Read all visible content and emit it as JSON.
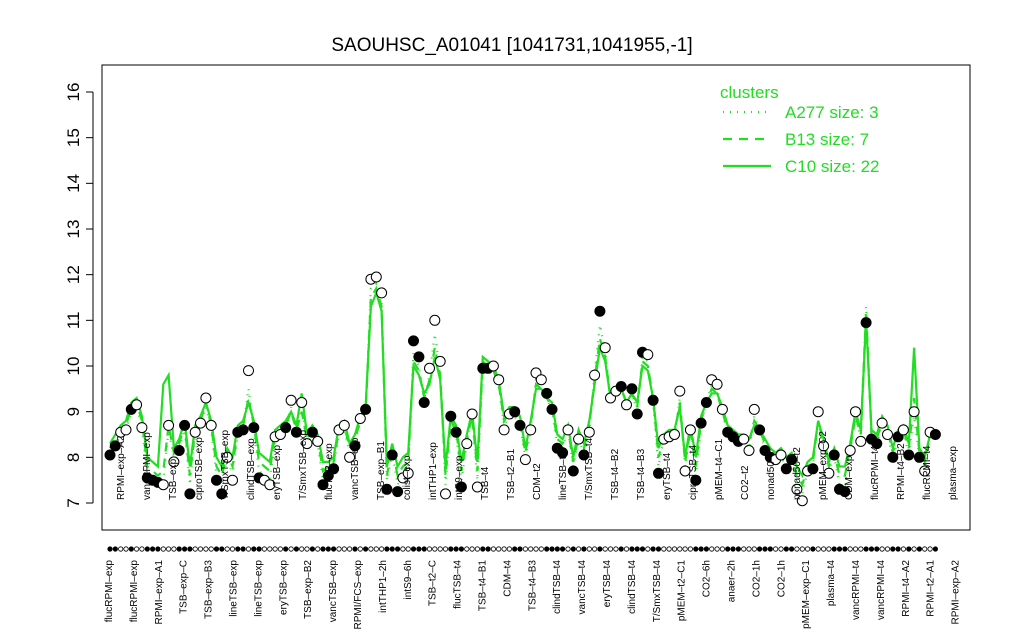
{
  "chart_data": {
    "type": "line",
    "title": "SAOUHSC_A01041 [1041731,1041955,-1]",
    "xlabel": "",
    "ylabel": "",
    "ylim": [
      7,
      16
    ],
    "yticks": [
      7,
      8,
      9,
      10,
      11,
      12,
      13,
      14,
      15,
      16
    ],
    "grid": false,
    "legend": {
      "title": "clusters",
      "placement": "top-right",
      "color": "#22dd22",
      "entries": [
        {
          "label": "A277 size: 3",
          "style": "dotted"
        },
        {
          "label": "B13 size: 7",
          "style": "dashed"
        },
        {
          "label": "C10 size: 22",
          "style": "solid"
        }
      ]
    },
    "x_labels_top": [
      "RPMI–exp–A2",
      "vancRPMI–exp",
      "TSB–exp",
      "ciproTSB–exp",
      "T/SmxTSB–exp",
      "clindTSB–exp",
      "eryTSB–exp",
      "T/SmxTSB–exp",
      "flucTSB–exp",
      "vancTSB–exp",
      "TSB–exp–B1",
      "colist–exp",
      "intTHP1–exp",
      "intS9–exp",
      "TSB–t4",
      "TSB–t2–B1",
      "CDM–t2",
      "lineTSB–t4",
      "T/SmxTSB–t4",
      "TSB–t4–B2",
      "TSB–t4–B3",
      "eryTSB–t4",
      "ciproTSB–t4",
      "pMEM–t4–C1",
      "CO2–t2",
      "nonad50–t",
      "nonad50–t2",
      "pMEM–exp–C2",
      "CDM–exp",
      "flucRPMI–t4",
      "RPMI–t4–B2",
      "flucRPMI–t4",
      "plasma–exp",
      "vancRPMI–exp"
    ],
    "x_labels_bottom": [
      "flucRPMI–exp",
      "flucRPMI–exp",
      "RPMI–exp–A1",
      "TSB–exp–C",
      "TSB–exp–B3",
      "lineTSB–exp",
      "lineTSB–exp",
      "eryTSB–exp",
      "TSB–exp–B2",
      "vancTSB–exp",
      "RPMI/FCS–exp",
      "intTHP1–2h",
      "intS9–6h",
      "TSB–t2–C",
      "flucTSB–t4",
      "TSB–t4–B1",
      "CDM–t4",
      "TSB–t4–B3",
      "clindTSB–t4",
      "vancTSB–t4",
      "eryTSB–t4",
      "clindTSB–t4",
      "T/SmxTSB–t4",
      "pMEM–t2–C1",
      "CO2–6h",
      "anaer–2h",
      "CO2–1h",
      "CO2–1h",
      "pMEM–exp–C1",
      "plasma–t4",
      "vancRPMI–t4",
      "vancRPMI–t4",
      "RPMI–t4–A2",
      "RPMI–t2–A1",
      "RPMI–exp–A2"
    ],
    "x": [
      1,
      2,
      3,
      4,
      5,
      6,
      7,
      8,
      9,
      10,
      11,
      12,
      13,
      14,
      15,
      16,
      17,
      18,
      19,
      20,
      21,
      22,
      23,
      24,
      25,
      26,
      27,
      28,
      29,
      30,
      31,
      32,
      33,
      34,
      35,
      36,
      37,
      38,
      39,
      40,
      41,
      42,
      43,
      44,
      45,
      46,
      47,
      48,
      49,
      50,
      51,
      52,
      53,
      54,
      55,
      56,
      57,
      58,
      59,
      60,
      61,
      62,
      63,
      64,
      65,
      66,
      67,
      68,
      69,
      70,
      71,
      72,
      73,
      74,
      75,
      76,
      77,
      78,
      79,
      80,
      81,
      82,
      83,
      84,
      85,
      86,
      87,
      88,
      89,
      90,
      91,
      92,
      93,
      94,
      95,
      96,
      97,
      98,
      99,
      100,
      101,
      102,
      103,
      104,
      105,
      106,
      107,
      108,
      109,
      110,
      111,
      112,
      113,
      114,
      115,
      116,
      117,
      118,
      119,
      120,
      121,
      122,
      123,
      124,
      125,
      126,
      127,
      128,
      129,
      130,
      131,
      132,
      133,
      134,
      135,
      136,
      137,
      138,
      139,
      140,
      141,
      142,
      143,
      144,
      145,
      146,
      147,
      148,
      149,
      150,
      151,
      152,
      153,
      154,
      155,
      156,
      157,
      158,
      159,
      160,
      161
    ],
    "points": [
      {
        "v": 8.05,
        "f": 1
      },
      {
        "v": 8.25,
        "f": 1
      },
      {
        "v": 8.55,
        "f": 0
      },
      {
        "v": 8.6,
        "f": 0
      },
      {
        "v": 9.05,
        "f": 1
      },
      {
        "v": 9.15,
        "f": 0
      },
      {
        "v": 8.65,
        "f": 0
      },
      {
        "v": 7.55,
        "f": 1
      },
      {
        "v": 7.5,
        "f": 1
      },
      {
        "v": 7.45,
        "f": 1
      },
      {
        "v": 7.4,
        "f": 0
      },
      {
        "v": 8.7,
        "f": 0
      },
      {
        "v": 7.9,
        "f": 0
      },
      {
        "v": 8.15,
        "f": 1
      },
      {
        "v": 8.7,
        "f": 1
      },
      {
        "v": 7.2,
        "f": 1
      },
      {
        "v": 8.55,
        "f": 0
      },
      {
        "v": 8.75,
        "f": 0
      },
      {
        "v": 9.3,
        "f": 0
      },
      {
        "v": 8.7,
        "f": 0
      },
      {
        "v": 7.5,
        "f": 1
      },
      {
        "v": 7.2,
        "f": 1
      },
      {
        "v": 8.0,
        "f": 0
      },
      {
        "v": 7.5,
        "f": 0
      },
      {
        "v": 8.55,
        "f": 1
      },
      {
        "v": 8.6,
        "f": 1
      },
      {
        "v": 9.9,
        "f": 0
      },
      {
        "v": 8.65,
        "f": 1
      },
      {
        "v": 7.55,
        "f": 1
      },
      {
        "v": 7.5,
        "f": 0
      },
      {
        "v": 7.4,
        "f": 0
      },
      {
        "v": 8.45,
        "f": 0
      },
      {
        "v": 8.5,
        "f": 0
      },
      {
        "v": 8.65,
        "f": 1
      },
      {
        "v": 9.25,
        "f": 0
      },
      {
        "v": 8.55,
        "f": 1
      },
      {
        "v": 9.2,
        "f": 0
      },
      {
        "v": 8.3,
        "f": 0
      },
      {
        "v": 8.55,
        "f": 1
      },
      {
        "v": 8.35,
        "f": 0
      },
      {
        "v": 7.4,
        "f": 1
      },
      {
        "v": 7.6,
        "f": 1
      },
      {
        "v": 7.75,
        "f": 1
      },
      {
        "v": 8.6,
        "f": 0
      },
      {
        "v": 8.7,
        "f": 0
      },
      {
        "v": 8.0,
        "f": 0
      },
      {
        "v": 8.25,
        "f": 1
      },
      {
        "v": 8.85,
        "f": 0
      },
      {
        "v": 9.05,
        "f": 1
      },
      {
        "v": 11.9,
        "f": 0
      },
      {
        "v": 11.95,
        "f": 0
      },
      {
        "v": 11.6,
        "f": 0
      },
      {
        "v": 7.3,
        "f": 1
      },
      {
        "v": 8.05,
        "f": 1
      },
      {
        "v": 7.25,
        "f": 1
      },
      {
        "v": 7.55,
        "f": 0
      },
      {
        "v": 7.65,
        "f": 0
      },
      {
        "v": 10.55,
        "f": 1
      },
      {
        "v": 10.2,
        "f": 1
      },
      {
        "v": 9.2,
        "f": 1
      },
      {
        "v": 9.95,
        "f": 0
      },
      {
        "v": 11.0,
        "f": 0
      },
      {
        "v": 10.1,
        "f": 0
      },
      {
        "v": 7.2,
        "f": 0
      },
      {
        "v": 8.9,
        "f": 1
      },
      {
        "v": 8.55,
        "f": 1
      },
      {
        "v": 7.35,
        "f": 1
      },
      {
        "v": 8.3,
        "f": 0
      },
      {
        "v": 8.95,
        "f": 0
      },
      {
        "v": 7.35,
        "f": 0
      },
      {
        "v": 9.95,
        "f": 1
      },
      {
        "v": 9.95,
        "f": 1
      },
      {
        "v": 10.0,
        "f": 0
      },
      {
        "v": 9.7,
        "f": 0
      },
      {
        "v": 8.6,
        "f": 0
      },
      {
        "v": 8.95,
        "f": 0
      },
      {
        "v": 9.0,
        "f": 1
      },
      {
        "v": 8.7,
        "f": 1
      },
      {
        "v": 7.95,
        "f": 0
      },
      {
        "v": 8.6,
        "f": 0
      },
      {
        "v": 9.85,
        "f": 0
      },
      {
        "v": 9.7,
        "f": 0
      },
      {
        "v": 9.4,
        "f": 1
      },
      {
        "v": 9.05,
        "f": 1
      },
      {
        "v": 8.2,
        "f": 1
      },
      {
        "v": 8.1,
        "f": 1
      },
      {
        "v": 8.6,
        "f": 0
      },
      {
        "v": 7.7,
        "f": 1
      },
      {
        "v": 8.4,
        "f": 0
      },
      {
        "v": 8.05,
        "f": 1
      },
      {
        "v": 8.55,
        "f": 0
      },
      {
        "v": 9.8,
        "f": 0
      },
      {
        "v": 11.2,
        "f": 1
      },
      {
        "v": 10.4,
        "f": 0
      },
      {
        "v": 9.3,
        "f": 0
      },
      {
        "v": 9.45,
        "f": 0
      },
      {
        "v": 9.55,
        "f": 1
      },
      {
        "v": 9.15,
        "f": 0
      },
      {
        "v": 9.5,
        "f": 1
      },
      {
        "v": 8.95,
        "f": 1
      },
      {
        "v": 10.3,
        "f": 1
      },
      {
        "v": 10.25,
        "f": 0
      },
      {
        "v": 9.25,
        "f": 1
      },
      {
        "v": 7.65,
        "f": 1
      },
      {
        "v": 8.4,
        "f": 0
      },
      {
        "v": 8.45,
        "f": 0
      },
      {
        "v": 8.5,
        "f": 0
      },
      {
        "v": 9.45,
        "f": 0
      },
      {
        "v": 7.7,
        "f": 0
      },
      {
        "v": 8.6,
        "f": 0
      },
      {
        "v": 7.5,
        "f": 1
      },
      {
        "v": 8.75,
        "f": 1
      },
      {
        "v": 9.2,
        "f": 1
      },
      {
        "v": 9.7,
        "f": 0
      },
      {
        "v": 9.6,
        "f": 0
      },
      {
        "v": 9.05,
        "f": 0
      },
      {
        "v": 8.55,
        "f": 1
      },
      {
        "v": 8.45,
        "f": 1
      },
      {
        "v": 8.35,
        "f": 1
      },
      {
        "v": 8.4,
        "f": 0
      },
      {
        "v": 8.15,
        "f": 0
      },
      {
        "v": 9.05,
        "f": 0
      },
      {
        "v": 8.6,
        "f": 1
      },
      {
        "v": 8.15,
        "f": 1
      },
      {
        "v": 8.0,
        "f": 1
      },
      {
        "v": 7.95,
        "f": 0
      },
      {
        "v": 8.05,
        "f": 0
      },
      {
        "v": 7.75,
        "f": 1
      },
      {
        "v": 7.95,
        "f": 1
      },
      {
        "v": 7.3,
        "f": 0
      },
      {
        "v": 7.05,
        "f": 0
      },
      {
        "v": 7.7,
        "f": 0
      },
      {
        "v": 7.75,
        "f": 1
      },
      {
        "v": 9.0,
        "f": 0
      },
      {
        "v": 8.25,
        "f": 0
      },
      {
        "v": 7.65,
        "f": 0
      },
      {
        "v": 8.05,
        "f": 1
      },
      {
        "v": 7.3,
        "f": 1
      },
      {
        "v": 7.25,
        "f": 1
      },
      {
        "v": 8.15,
        "f": 0
      },
      {
        "v": 9.0,
        "f": 0
      },
      {
        "v": 8.35,
        "f": 0
      },
      {
        "v": 10.95,
        "f": 1
      },
      {
        "v": 8.4,
        "f": 1
      },
      {
        "v": 8.3,
        "f": 1
      },
      {
        "v": 8.75,
        "f": 0
      },
      {
        "v": 8.5,
        "f": 0
      },
      {
        "v": 8.0,
        "f": 1
      },
      {
        "v": 8.45,
        "f": 1
      },
      {
        "v": 8.6,
        "f": 0
      },
      {
        "v": 8.05,
        "f": 1
      },
      {
        "v": 9.0,
        "f": 0
      },
      {
        "v": 8.0,
        "f": 1
      },
      {
        "v": 7.7,
        "f": 0
      },
      {
        "v": 8.55,
        "f": 0
      },
      {
        "v": 8.5,
        "f": 1
      }
    ],
    "series": [
      {
        "name": "A277 size: 3",
        "style": "dotted",
        "values": [
          8.1,
          8.3,
          8.5,
          8.6,
          9.0,
          9.1,
          8.7,
          7.6,
          7.5,
          7.5,
          7.5,
          8.6,
          8.0,
          8.2,
          8.6,
          7.4,
          8.5,
          8.7,
          9.1,
          8.6,
          7.6,
          7.4,
          8.0,
          7.6,
          8.5,
          8.6,
          9.5,
          8.6,
          7.7,
          7.6,
          7.5,
          8.4,
          8.5,
          8.6,
          9.1,
          8.5,
          9.1,
          8.3,
          8.5,
          8.3,
          7.5,
          7.7,
          7.8,
          8.5,
          8.6,
          8.1,
          8.3,
          8.8,
          9.0,
          11.7,
          11.8,
          11.4,
          7.5,
          8.1,
          7.4,
          7.6,
          7.8,
          10.3,
          10.0,
          9.2,
          9.8,
          10.7,
          9.9,
          7.4,
          8.8,
          8.5,
          7.5,
          8.3,
          8.9,
          7.5,
          10.0,
          9.9,
          9.9,
          9.6,
          8.7,
          8.9,
          8.9,
          8.7,
          8.0,
          8.6,
          9.7,
          9.6,
          9.3,
          9.0,
          8.3,
          8.2,
          8.6,
          7.8,
          8.4,
          8.1,
          8.6,
          9.8,
          10.9,
          10.3,
          9.3,
          9.4,
          9.5,
          9.2,
          9.4,
          9.0,
          10.2,
          10.1,
          9.2,
          7.8,
          8.4,
          8.4,
          8.5,
          9.3,
          7.8,
          8.6,
          7.6,
          8.7,
          9.2,
          9.6,
          9.5,
          9.0,
          8.5,
          8.4,
          8.3,
          8.4,
          8.2,
          8.9,
          8.6,
          8.2,
          8.0,
          7.9,
          8.0,
          7.8,
          7.9,
          7.4,
          7.2,
          7.7,
          7.8,
          8.8,
          8.2,
          7.7,
          8.0,
          7.4,
          7.4,
          8.1,
          8.9,
          8.4,
          11.3,
          8.4,
          8.3,
          8.7,
          8.5,
          8.0,
          8.4,
          8.5,
          8.1,
          8.9,
          8.0,
          7.8,
          8.5,
          8.5
        ]
      },
      {
        "name": "B13 size: 7",
        "style": "dashed",
        "values": [
          8.2,
          8.4,
          8.6,
          8.7,
          9.1,
          9.2,
          8.8,
          7.8,
          7.7,
          7.6,
          7.7,
          8.7,
          8.1,
          8.3,
          8.7,
          7.6,
          8.6,
          8.8,
          9.2,
          8.7,
          7.8,
          7.6,
          8.1,
          7.8,
          8.6,
          8.7,
          9.3,
          8.7,
          7.9,
          7.8,
          7.7,
          8.5,
          8.6,
          8.7,
          9.0,
          8.6,
          9.0,
          8.4,
          8.6,
          8.4,
          7.7,
          7.8,
          7.9,
          8.6,
          8.7,
          8.2,
          8.4,
          8.8,
          9.0,
          11.5,
          11.7,
          11.3,
          7.6,
          8.2,
          7.6,
          7.8,
          7.9,
          10.1,
          9.9,
          9.3,
          9.7,
          10.4,
          9.8,
          7.6,
          8.8,
          8.6,
          7.7,
          8.4,
          8.9,
          7.7,
          10.1,
          10.0,
          9.9,
          9.6,
          8.8,
          9.0,
          9.0,
          8.8,
          8.1,
          8.7,
          9.6,
          9.5,
          9.3,
          9.1,
          8.4,
          8.3,
          8.6,
          7.9,
          8.5,
          8.2,
          8.7,
          9.7,
          10.6,
          10.2,
          9.3,
          9.4,
          9.5,
          9.2,
          9.4,
          9.1,
          10.1,
          10.0,
          9.3,
          8.0,
          8.4,
          8.5,
          8.5,
          9.2,
          7.9,
          8.6,
          7.8,
          8.8,
          9.2,
          9.5,
          9.4,
          9.0,
          8.6,
          8.5,
          8.4,
          8.4,
          8.3,
          8.8,
          8.6,
          8.3,
          8.1,
          8.0,
          8.1,
          7.9,
          8.0,
          7.6,
          7.4,
          7.8,
          7.9,
          8.8,
          8.3,
          7.8,
          8.1,
          7.6,
          7.6,
          8.2,
          8.9,
          8.5,
          11.2,
          8.5,
          8.4,
          8.8,
          8.6,
          8.1,
          8.5,
          8.6,
          8.2,
          9.3,
          8.1,
          7.9,
          8.5,
          8.5
        ]
      },
      {
        "name": "C10 size: 22",
        "style": "solid",
        "values": [
          8.3,
          8.5,
          8.7,
          8.8,
          9.2,
          9.3,
          8.9,
          8.0,
          7.9,
          7.8,
          9.6,
          9.8,
          8.2,
          8.4,
          8.8,
          7.8,
          8.7,
          8.9,
          9.2,
          8.8,
          8.0,
          7.8,
          8.2,
          8.0,
          8.7,
          8.8,
          9.2,
          8.8,
          8.1,
          8.0,
          7.9,
          8.6,
          8.7,
          8.8,
          9.0,
          8.7,
          9.4,
          8.5,
          8.7,
          8.5,
          7.9,
          7.9,
          8.0,
          8.7,
          8.8,
          8.3,
          8.5,
          8.9,
          9.1,
          11.3,
          11.6,
          11.2,
          7.8,
          8.3,
          7.8,
          8.0,
          8.1,
          10.0,
          9.8,
          9.4,
          9.6,
          10.2,
          9.7,
          7.8,
          8.9,
          8.7,
          7.9,
          8.5,
          9.0,
          7.9,
          10.2,
          10.1,
          10.0,
          9.7,
          8.9,
          9.1,
          9.1,
          8.9,
          8.2,
          8.8,
          9.5,
          9.5,
          9.3,
          9.2,
          8.5,
          8.4,
          8.7,
          8.0,
          8.6,
          8.3,
          8.8,
          9.6,
          10.4,
          10.1,
          9.3,
          9.4,
          9.5,
          9.2,
          9.4,
          9.2,
          10.0,
          9.9,
          9.3,
          8.2,
          8.5,
          8.6,
          8.6,
          9.1,
          8.0,
          8.7,
          8.0,
          8.9,
          9.2,
          9.4,
          9.4,
          9.1,
          8.7,
          8.6,
          8.5,
          8.5,
          8.4,
          8.7,
          8.6,
          8.4,
          8.2,
          8.1,
          8.2,
          8.0,
          8.1,
          7.8,
          7.6,
          7.9,
          8.0,
          8.8,
          8.4,
          7.9,
          8.2,
          7.8,
          7.8,
          8.3,
          9.0,
          8.6,
          11.0,
          8.6,
          8.5,
          8.9,
          8.7,
          8.2,
          8.6,
          8.7,
          8.3,
          10.4,
          8.2,
          8.0,
          8.5,
          8.5
        ]
      }
    ]
  }
}
